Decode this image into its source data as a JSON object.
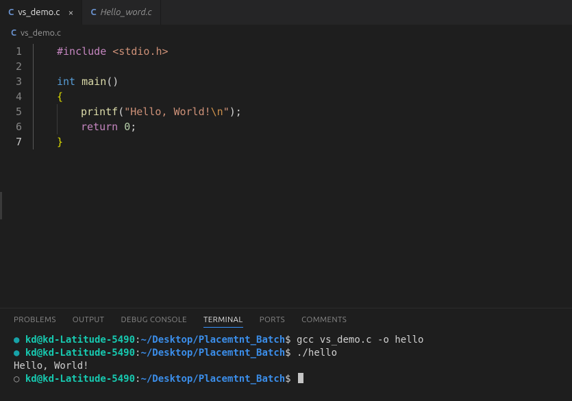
{
  "tabs": [
    {
      "lang": "C",
      "name": "vs_demo.c",
      "active": true,
      "has_close": true
    },
    {
      "lang": "C",
      "name": "Hello_word.c",
      "active": false,
      "has_close": false
    }
  ],
  "breadcrumb": {
    "lang": "C",
    "file": "vs_demo.c"
  },
  "editor": {
    "current_line": 7,
    "lines": [
      {
        "n": 1,
        "indent": 1,
        "tokens": [
          {
            "cls": "tok-dir",
            "t": "#include"
          },
          {
            "cls": "",
            "t": " "
          },
          {
            "cls": "tok-inc",
            "t": "<stdio.h>"
          }
        ]
      },
      {
        "n": 2,
        "indent": 1,
        "tokens": []
      },
      {
        "n": 3,
        "indent": 1,
        "tokens": [
          {
            "cls": "tok-type",
            "t": "int"
          },
          {
            "cls": "",
            "t": " "
          },
          {
            "cls": "tok-func",
            "t": "main"
          },
          {
            "cls": "tok-punc",
            "t": "()"
          }
        ]
      },
      {
        "n": 4,
        "indent": 1,
        "tokens": [
          {
            "cls": "tok-brace",
            "t": "{"
          }
        ]
      },
      {
        "n": 5,
        "indent": 2,
        "tokens": [
          {
            "cls": "tok-func",
            "t": "printf"
          },
          {
            "cls": "tok-punc",
            "t": "("
          },
          {
            "cls": "tok-str",
            "t": "\"Hello, World!"
          },
          {
            "cls": "tok-esc",
            "t": "\\n"
          },
          {
            "cls": "tok-str",
            "t": "\""
          },
          {
            "cls": "tok-punc",
            "t": ");"
          }
        ]
      },
      {
        "n": 6,
        "indent": 2,
        "tokens": [
          {
            "cls": "tok-ctrl",
            "t": "return"
          },
          {
            "cls": "",
            "t": " "
          },
          {
            "cls": "tok-num",
            "t": "0"
          },
          {
            "cls": "tok-punc",
            "t": ";"
          }
        ]
      },
      {
        "n": 7,
        "indent": 1,
        "tokens": [
          {
            "cls": "tok-brace",
            "t": "}"
          }
        ]
      }
    ]
  },
  "panel_tabs": [
    {
      "label": "PROBLEMS",
      "active": false
    },
    {
      "label": "OUTPUT",
      "active": false
    },
    {
      "label": "DEBUG CONSOLE",
      "active": false
    },
    {
      "label": "TERMINAL",
      "active": true
    },
    {
      "label": "PORTS",
      "active": false
    },
    {
      "label": "COMMENTS",
      "active": false
    }
  ],
  "terminal": {
    "prompt": {
      "userhost": "kd@kd-Latitude-5490",
      "cwd": "~/Desktop/Placemtnt_Batch",
      "symbol": "$"
    },
    "lines": [
      {
        "bullet": "filled",
        "type": "prompt",
        "command": "gcc vs_demo.c -o hello"
      },
      {
        "bullet": "filled",
        "type": "prompt",
        "command": "./hello"
      },
      {
        "bullet": null,
        "type": "output",
        "text": "Hello, World!"
      },
      {
        "bullet": "open",
        "type": "prompt",
        "command": "",
        "cursor": true
      }
    ]
  }
}
